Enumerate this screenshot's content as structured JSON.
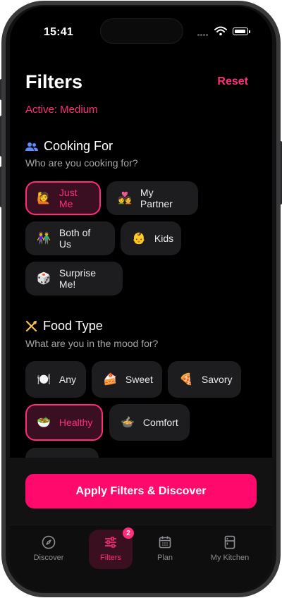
{
  "status_bar": {
    "time": "15:41"
  },
  "header": {
    "title": "Filters",
    "reset_label": "Reset",
    "active_label": "Active: Medium"
  },
  "cooking_for": {
    "title": "Cooking For",
    "subtitle": "Who are you cooking for?",
    "options": [
      {
        "emoji": "🙋",
        "label": "Just Me",
        "selected": true
      },
      {
        "emoji": "💑",
        "label": "My Partner",
        "selected": false
      },
      {
        "emoji": "👫",
        "label": "Both of Us",
        "selected": false
      },
      {
        "emoji": "👶",
        "label": "Kids",
        "selected": false
      },
      {
        "emoji": "🎲",
        "label": "Surprise Me!",
        "selected": false
      }
    ]
  },
  "food_type": {
    "title": "Food Type",
    "subtitle": "What are you in the mood for?",
    "options": [
      {
        "emoji": "🍽️",
        "label": "Any",
        "selected": false
      },
      {
        "emoji": "🍰",
        "label": "Sweet",
        "selected": false
      },
      {
        "emoji": "🍕",
        "label": "Savory",
        "selected": false
      },
      {
        "emoji": "🥗",
        "label": "Healthy",
        "selected": true
      },
      {
        "emoji": "🍲",
        "label": "Comfort",
        "selected": false
      }
    ]
  },
  "apply_button": {
    "label": "Apply Filters & Discover"
  },
  "tabbar": {
    "tabs": [
      {
        "label": "Discover",
        "icon": "compass-icon"
      },
      {
        "label": "Filters",
        "icon": "sliders-icon",
        "badge": "2",
        "active": true
      },
      {
        "label": "Plan",
        "icon": "calendar-icon"
      },
      {
        "label": "My Kitchen",
        "icon": "fridge-icon"
      }
    ]
  },
  "colors": {
    "accent": "#ff2d7a",
    "button": "#ff0a6c",
    "background": "#000000"
  }
}
